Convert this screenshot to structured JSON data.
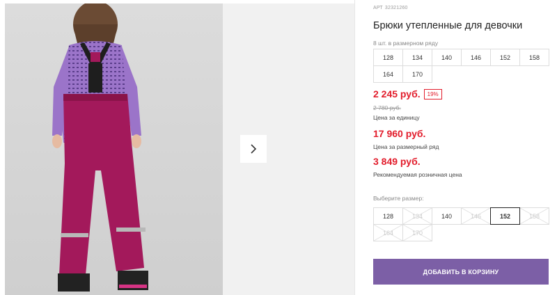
{
  "product": {
    "article_label": "АРТ",
    "article": "32321260",
    "title": "Брюки утепленные для девочки",
    "range_note": "8 шт. в размерном ряду"
  },
  "size_range": [
    "128",
    "134",
    "140",
    "146",
    "152",
    "158",
    "164",
    "170"
  ],
  "prices": {
    "unit_price": "2 245 руб.",
    "discount": "19%",
    "old_price": "2 780 руб.",
    "unit_label": "Цена за единицу",
    "range_price": "17 960 руб.",
    "range_label": "Цена за размерный ряд",
    "retail_price": "3 849 руб.",
    "retail_label": "Рекомендуемая розничная цена"
  },
  "size_selector": {
    "label": "Выберите размер:",
    "selected": "152",
    "sizes": [
      {
        "value": "128",
        "available": true
      },
      {
        "value": "134",
        "available": false
      },
      {
        "value": "140",
        "available": true
      },
      {
        "value": "146",
        "available": false
      },
      {
        "value": "152",
        "available": true
      },
      {
        "value": "158",
        "available": false
      },
      {
        "value": "164",
        "available": false
      },
      {
        "value": "170",
        "available": false
      }
    ]
  },
  "cart_button": "ДОБАВИТЬ В КОРЗИНУ",
  "gallery": {
    "next_icon": "chevron-right-icon"
  },
  "colors": {
    "accent": "#7c5fa6",
    "price_red": "#e21c2b",
    "pants": "#a3195b",
    "shirt": "#9b74c9"
  }
}
